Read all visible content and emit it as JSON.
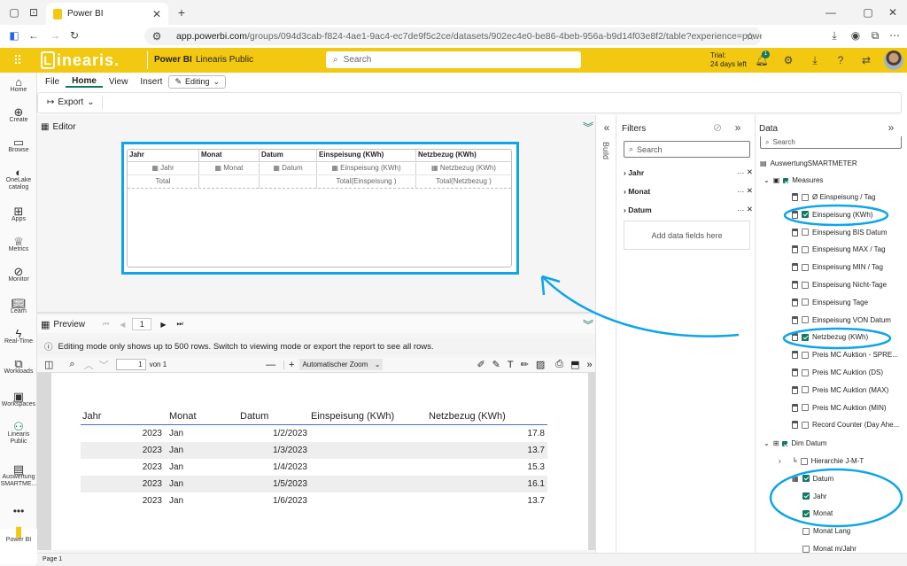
{
  "browser": {
    "tab_title": "Power BI",
    "url_host": "app.powerbi.com",
    "url_path": "/groups/094d3cab-f824-4ae1-9ac4-ec7de9f5c2ce/datasets/902ec4e0-be86-4beb-956a-b9d14f03e8f2/table?experience=power-bi"
  },
  "header": {
    "brand": "inearis.",
    "brand_letter": "L",
    "app": "Power BI",
    "workspace": "Linearis Public",
    "search_placeholder": "Search",
    "trial_line1": "Trial:",
    "trial_line2": "24 days left",
    "notif_count": "1"
  },
  "rail": [
    {
      "label": "Home",
      "icon": "home-icon"
    },
    {
      "label": "Create",
      "icon": "create-icon"
    },
    {
      "label": "Browse",
      "icon": "folder-icon"
    },
    {
      "label": "OneLake catalog",
      "icon": "onelake-icon"
    },
    {
      "label": "Apps",
      "icon": "apps-icon"
    },
    {
      "label": "Metrics",
      "icon": "trophy-icon"
    },
    {
      "label": "Monitor",
      "icon": "monitor-icon"
    },
    {
      "label": "Learn",
      "icon": "book-icon"
    },
    {
      "label": "Real-Time",
      "icon": "lightning-icon"
    },
    {
      "label": "Workloads",
      "icon": "workloads-icon"
    },
    {
      "label": "Workspaces",
      "icon": "workspaces-icon"
    },
    {
      "label": "Linearis Public",
      "icon": "people-icon"
    },
    {
      "label": "Auswertung SMARTME...",
      "icon": "dataset-icon"
    },
    {
      "label": "Power BI",
      "icon": "powerbi-icon"
    }
  ],
  "menu": {
    "file": "File",
    "home": "Home",
    "view": "View",
    "insert": "Insert",
    "editing": "Editing"
  },
  "toolbar": {
    "export": "Export"
  },
  "editor": {
    "title": "Editor",
    "build": "Build"
  },
  "visual_table": {
    "headers": [
      "Jahr",
      "Monat",
      "Datum",
      "Einspeisung (KWh)",
      "Netzbezug (KWh)"
    ],
    "fields": [
      "Jahr",
      "Monat",
      "Datum",
      "Einspeisung (KWh)",
      "Netzbezug (KWh)"
    ],
    "totals": [
      "Total",
      "",
      "",
      "Total(Einspeisung )",
      "Total(Netzbezug )"
    ]
  },
  "preview": {
    "title": "Preview",
    "page": "1",
    "notice": "Editing mode only shows up to 500 rows. Switch to viewing mode or export the report to see all rows.",
    "pdf_page": "1",
    "pdf_of": "von 1",
    "zoom": "Automatischer Zoom"
  },
  "preview_table": {
    "headers": [
      "Jahr",
      "Monat",
      "Datum",
      "Einspeisung (KWh)",
      "Netzbezug (KWh)"
    ],
    "rows": [
      [
        "2023",
        "Jan",
        "1/2/2023",
        "",
        "17.8"
      ],
      [
        "2023",
        "Jan",
        "1/3/2023",
        "",
        "13.7"
      ],
      [
        "2023",
        "Jan",
        "1/4/2023",
        "",
        "15.3"
      ],
      [
        "2023",
        "Jan",
        "1/5/2023",
        "",
        "16.1"
      ],
      [
        "2023",
        "Jan",
        "1/6/2023",
        "",
        "13.7"
      ]
    ]
  },
  "filters": {
    "title": "Filters",
    "search": "Search",
    "items": [
      "Jahr",
      "Monat",
      "Datum"
    ],
    "add": "Add data fields here"
  },
  "data": {
    "title": "Data",
    "search": "Search",
    "dataset": "AuswertungSMARTMETER",
    "measures_group": "Measures",
    "measures": [
      {
        "label": "Ø Einspeisung / Tag",
        "checked": false
      },
      {
        "label": "Einspeisung (KWh)",
        "checked": true
      },
      {
        "label": "Einspeisung BIS Datum",
        "checked": false
      },
      {
        "label": "Einspeisung MAX / Tag",
        "checked": false
      },
      {
        "label": "Einspeisung MIN / Tag",
        "checked": false
      },
      {
        "label": "Einspeisung Nicht-Tage",
        "checked": false
      },
      {
        "label": "Einspeisung Tage",
        "checked": false
      },
      {
        "label": "Einspeisung VON Datum",
        "checked": false
      },
      {
        "label": "Netzbezug (KWh)",
        "checked": true
      },
      {
        "label": "Preis MC Auktion - SPRE...",
        "checked": false
      },
      {
        "label": "Preis MC Auktion (DS)",
        "checked": false
      },
      {
        "label": "Preis MC Auktion (MAX)",
        "checked": false
      },
      {
        "label": "Preis MC Auktion (MIN)",
        "checked": false
      },
      {
        "label": "Record Counter (Day Ahe...",
        "checked": false
      }
    ],
    "dim_group": "Dim Datum",
    "dim_items": [
      {
        "label": "Hierarchie J-M-T",
        "checked": false,
        "indent": 1
      },
      {
        "label": "Datum",
        "checked": true,
        "indent": 1
      },
      {
        "label": "Jahr",
        "checked": true,
        "indent": 1
      },
      {
        "label": "Monat",
        "checked": true,
        "indent": 1
      },
      {
        "label": "Monat Lang",
        "checked": false,
        "indent": 1
      },
      {
        "label": "Monat m/Jahr",
        "checked": false,
        "indent": 1
      }
    ]
  },
  "status": {
    "page": "Page 1"
  },
  "colors": {
    "accent": "#f2c811",
    "highlight": "#0ea5e9",
    "check": "#117865"
  }
}
